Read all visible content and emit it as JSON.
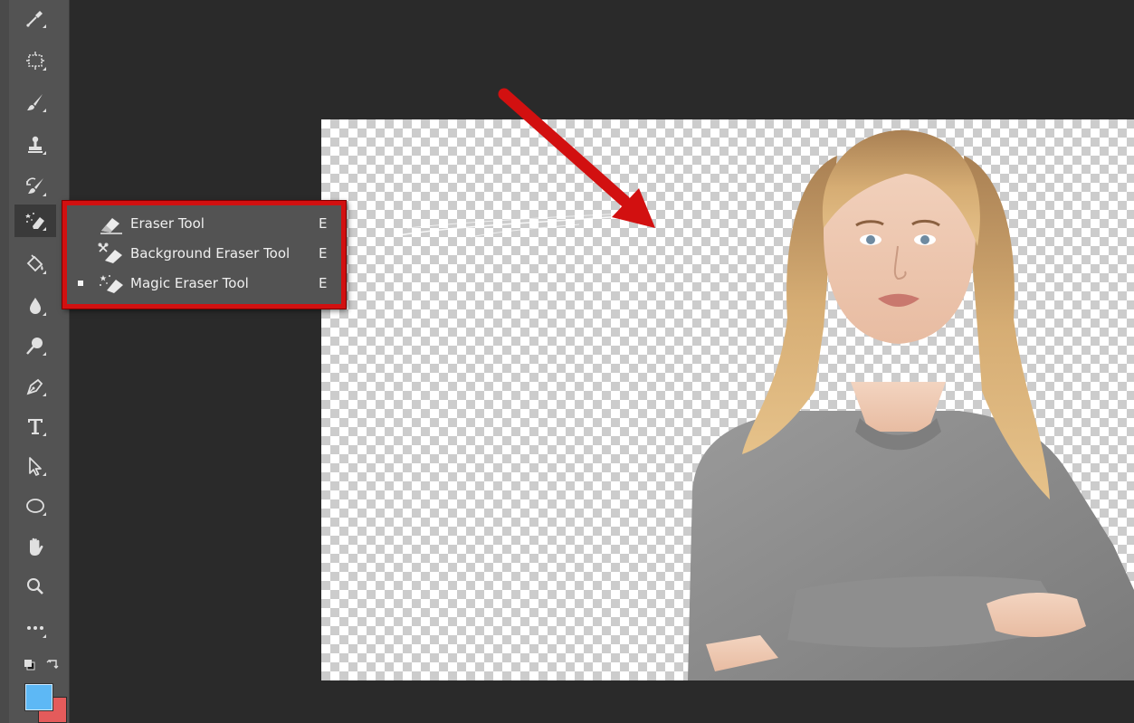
{
  "toolbar": {
    "tools": [
      {
        "name": "eyedropper-tool",
        "icon": "eyedropper-icon"
      },
      {
        "name": "artboard-tool",
        "icon": "artboard-icon"
      },
      {
        "name": "brush-tool",
        "icon": "brush-icon"
      },
      {
        "name": "clone-stamp-tool",
        "icon": "stamp-icon"
      },
      {
        "name": "history-brush-tool",
        "icon": "history-brush-icon"
      },
      {
        "name": "eraser-tool-group",
        "icon": "magic-eraser-icon",
        "active": true
      },
      {
        "name": "paint-bucket-tool",
        "icon": "paint-bucket-icon"
      },
      {
        "name": "blur-tool",
        "icon": "drop-icon"
      },
      {
        "name": "dodge-tool",
        "icon": "dodge-icon"
      },
      {
        "name": "pen-tool",
        "icon": "pen-icon"
      },
      {
        "name": "type-tool",
        "icon": "type-icon",
        "glyph": "T"
      },
      {
        "name": "path-selection-tool",
        "icon": "arrow-cursor-icon"
      },
      {
        "name": "ellipse-tool",
        "icon": "ellipse-icon"
      },
      {
        "name": "hand-tool",
        "icon": "hand-icon"
      },
      {
        "name": "zoom-tool",
        "icon": "magnifier-icon"
      },
      {
        "name": "edit-toolbar",
        "icon": "more-icon",
        "glyph": "•••"
      }
    ],
    "colors": {
      "foreground": "#5db8f5",
      "background": "#e45b5b"
    }
  },
  "flyout": {
    "items": [
      {
        "label": "Eraser Tool",
        "shortcut": "E",
        "selected": false,
        "icon": "eraser-icon"
      },
      {
        "label": "Background Eraser Tool",
        "shortcut": "E",
        "selected": false,
        "icon": "background-eraser-icon"
      },
      {
        "label": "Magic Eraser Tool",
        "shortcut": "E",
        "selected": true,
        "icon": "magic-eraser-icon"
      }
    ],
    "highlight_color": "#d21010"
  },
  "annotation": {
    "arrow_color": "#d21010"
  }
}
